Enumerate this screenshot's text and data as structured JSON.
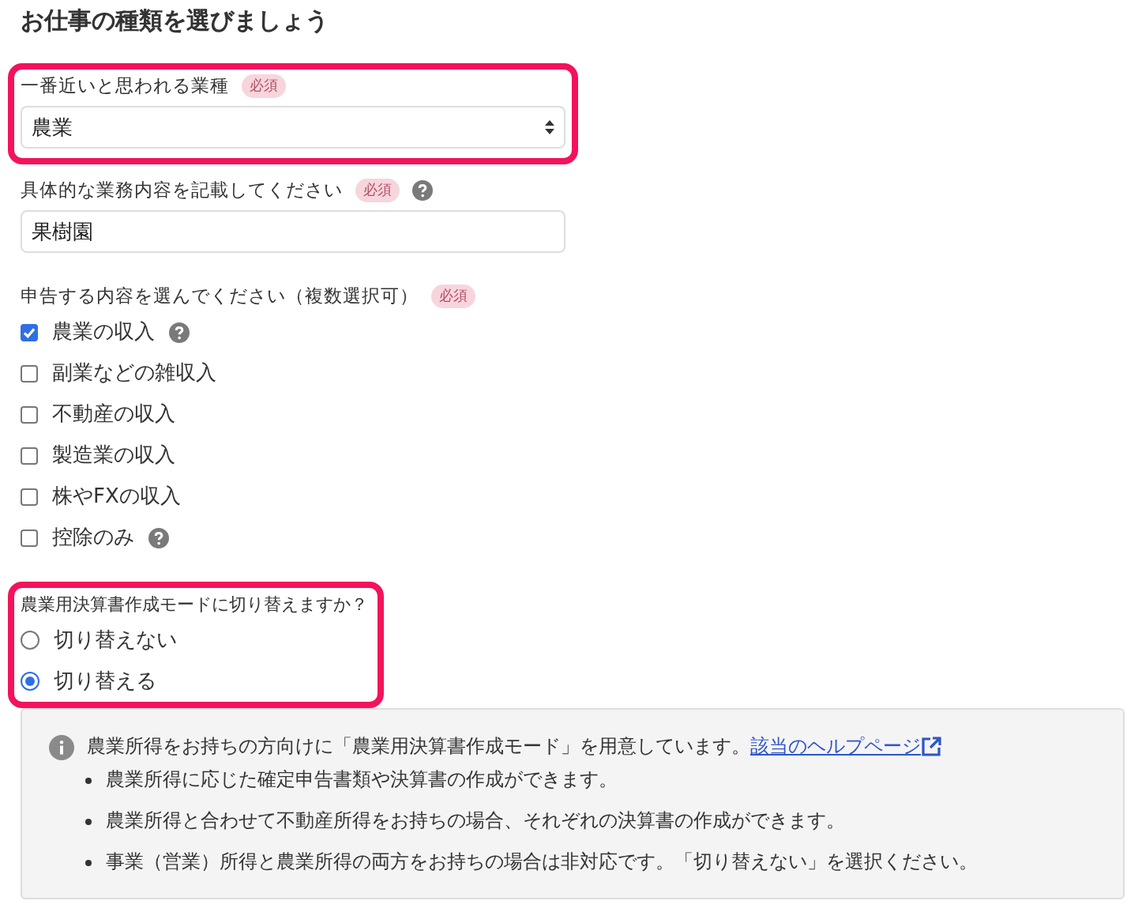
{
  "title": "お仕事の種類を選びましょう",
  "industry": {
    "label": "一番近いと思われる業種",
    "required": "必須",
    "value": "農業",
    "highlighted": true
  },
  "details": {
    "label": "具体的な業務内容を記載してください",
    "required": "必須",
    "help": true,
    "value": "果樹園"
  },
  "income": {
    "label": "申告する内容を選んでください（複数選択可）",
    "required": "必須",
    "options": [
      {
        "label": "農業の収入",
        "checked": true,
        "help": true
      },
      {
        "label": "副業などの雑収入",
        "checked": false,
        "help": false
      },
      {
        "label": "不動産の収入",
        "checked": false,
        "help": false
      },
      {
        "label": "製造業の収入",
        "checked": false,
        "help": false
      },
      {
        "label": "株やFXの収入",
        "checked": false,
        "help": false
      },
      {
        "label": "控除のみ",
        "checked": false,
        "help": true
      }
    ]
  },
  "mode": {
    "label": "農業用決算書作成モードに切り替えますか？",
    "highlighted": true,
    "options": [
      {
        "label": "切り替えない",
        "selected": false
      },
      {
        "label": "切り替える",
        "selected": true
      }
    ]
  },
  "info": {
    "text": "農業所得をお持ちの方向けに「農業用決算書作成モード」を用意しています。",
    "link": "該当のヘルプページ",
    "bullets": [
      "農業所得に応じた確定申告書類や決算書の作成ができます。",
      "農業所得と合わせて不動産所得をお持ちの場合、それぞれの決算書の作成ができます。",
      "事業（営業）所得と農業所得の両方をお持ちの場合は非対応です。「切り替えない」を選択ください。"
    ]
  }
}
